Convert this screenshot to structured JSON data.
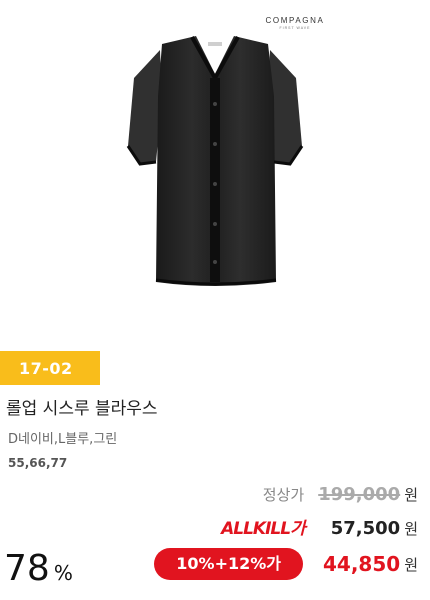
{
  "brand": {
    "name": "COMPAGNA",
    "sub": "FIRST WAVE"
  },
  "product": {
    "code": "17-02",
    "title": "롤업 시스루 블라우스",
    "colors": "D네이비,L블루,그린",
    "sizes": "55,66,77",
    "image_icon": "black-sheer-blouse"
  },
  "prices": {
    "regular_label": "정상가",
    "regular": "199,000",
    "allkill_logo": "ALLKILL가",
    "allkill": "57,500",
    "coupon": "10%+12%가",
    "final": "44,850",
    "currency": "원"
  },
  "discount": {
    "value": "78",
    "unit": "%"
  },
  "colors": {
    "badge": "#f9bd1b",
    "accent": "#e1141f"
  }
}
